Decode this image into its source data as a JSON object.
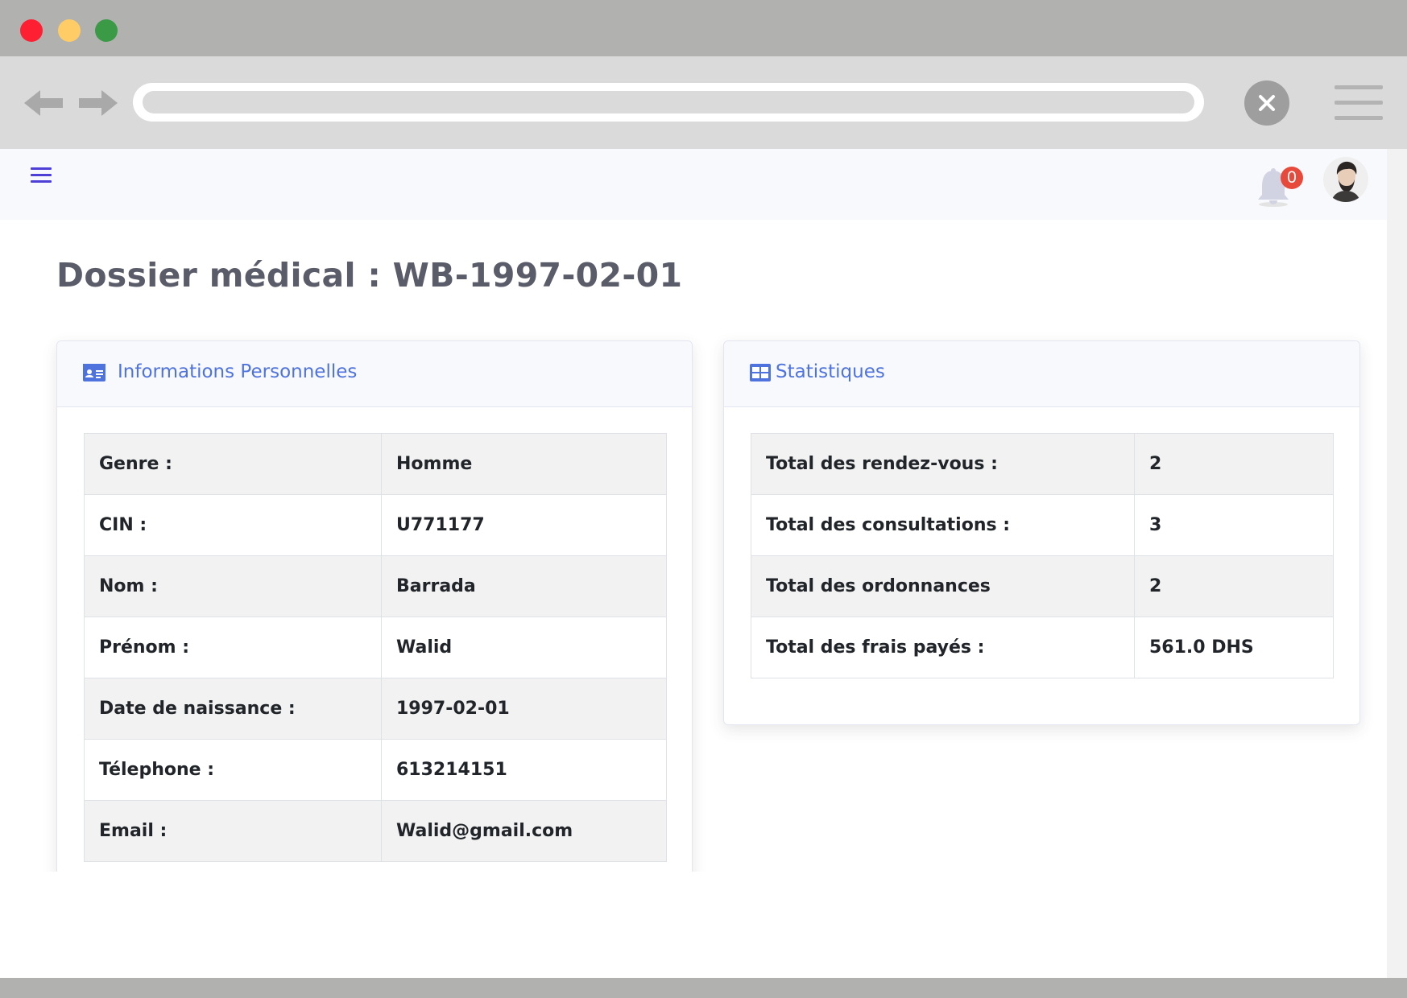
{
  "header": {
    "notification_count": "0"
  },
  "page": {
    "title": "Dossier médical : WB-1997-02-01"
  },
  "personal_card": {
    "title": "Informations Personnelles",
    "rows": [
      {
        "label": "Genre :",
        "value": "Homme"
      },
      {
        "label": "CIN :",
        "value": "U771177"
      },
      {
        "label": "Nom :",
        "value": "Barrada"
      },
      {
        "label": "Prénom :",
        "value": "Walid"
      },
      {
        "label": "Date de naissance :",
        "value": "1997-02-01"
      },
      {
        "label": "Télephone :",
        "value": "613214151"
      },
      {
        "label": "Email :",
        "value": "Walid@gmail.com"
      }
    ]
  },
  "stats_card": {
    "title": "Statistiques",
    "rows": [
      {
        "label": "Total des rendez-vous :",
        "value": "2"
      },
      {
        "label": "Total des consultations :",
        "value": "3"
      },
      {
        "label": "Total des ordonnances",
        "value": "2"
      },
      {
        "label": "Total des frais payés :",
        "value": "561.0 DHS"
      }
    ]
  },
  "icons": {
    "window_controls": [
      "close-dot",
      "minimize-dot",
      "maximize-dot"
    ],
    "toolbar": [
      "back-arrow-icon",
      "forward-arrow-icon",
      "close-icon",
      "menu-icon"
    ],
    "topbar": [
      "hamburger-icon",
      "bell-icon",
      "avatar"
    ],
    "cards": [
      "id-card-icon",
      "table-icon"
    ]
  },
  "colors": {
    "accent": "#4e73df",
    "hamburger": "#4e3fd6",
    "badge": "#e74a3b",
    "title": "#5a5c69",
    "striped_row": "#f2f2f2"
  }
}
